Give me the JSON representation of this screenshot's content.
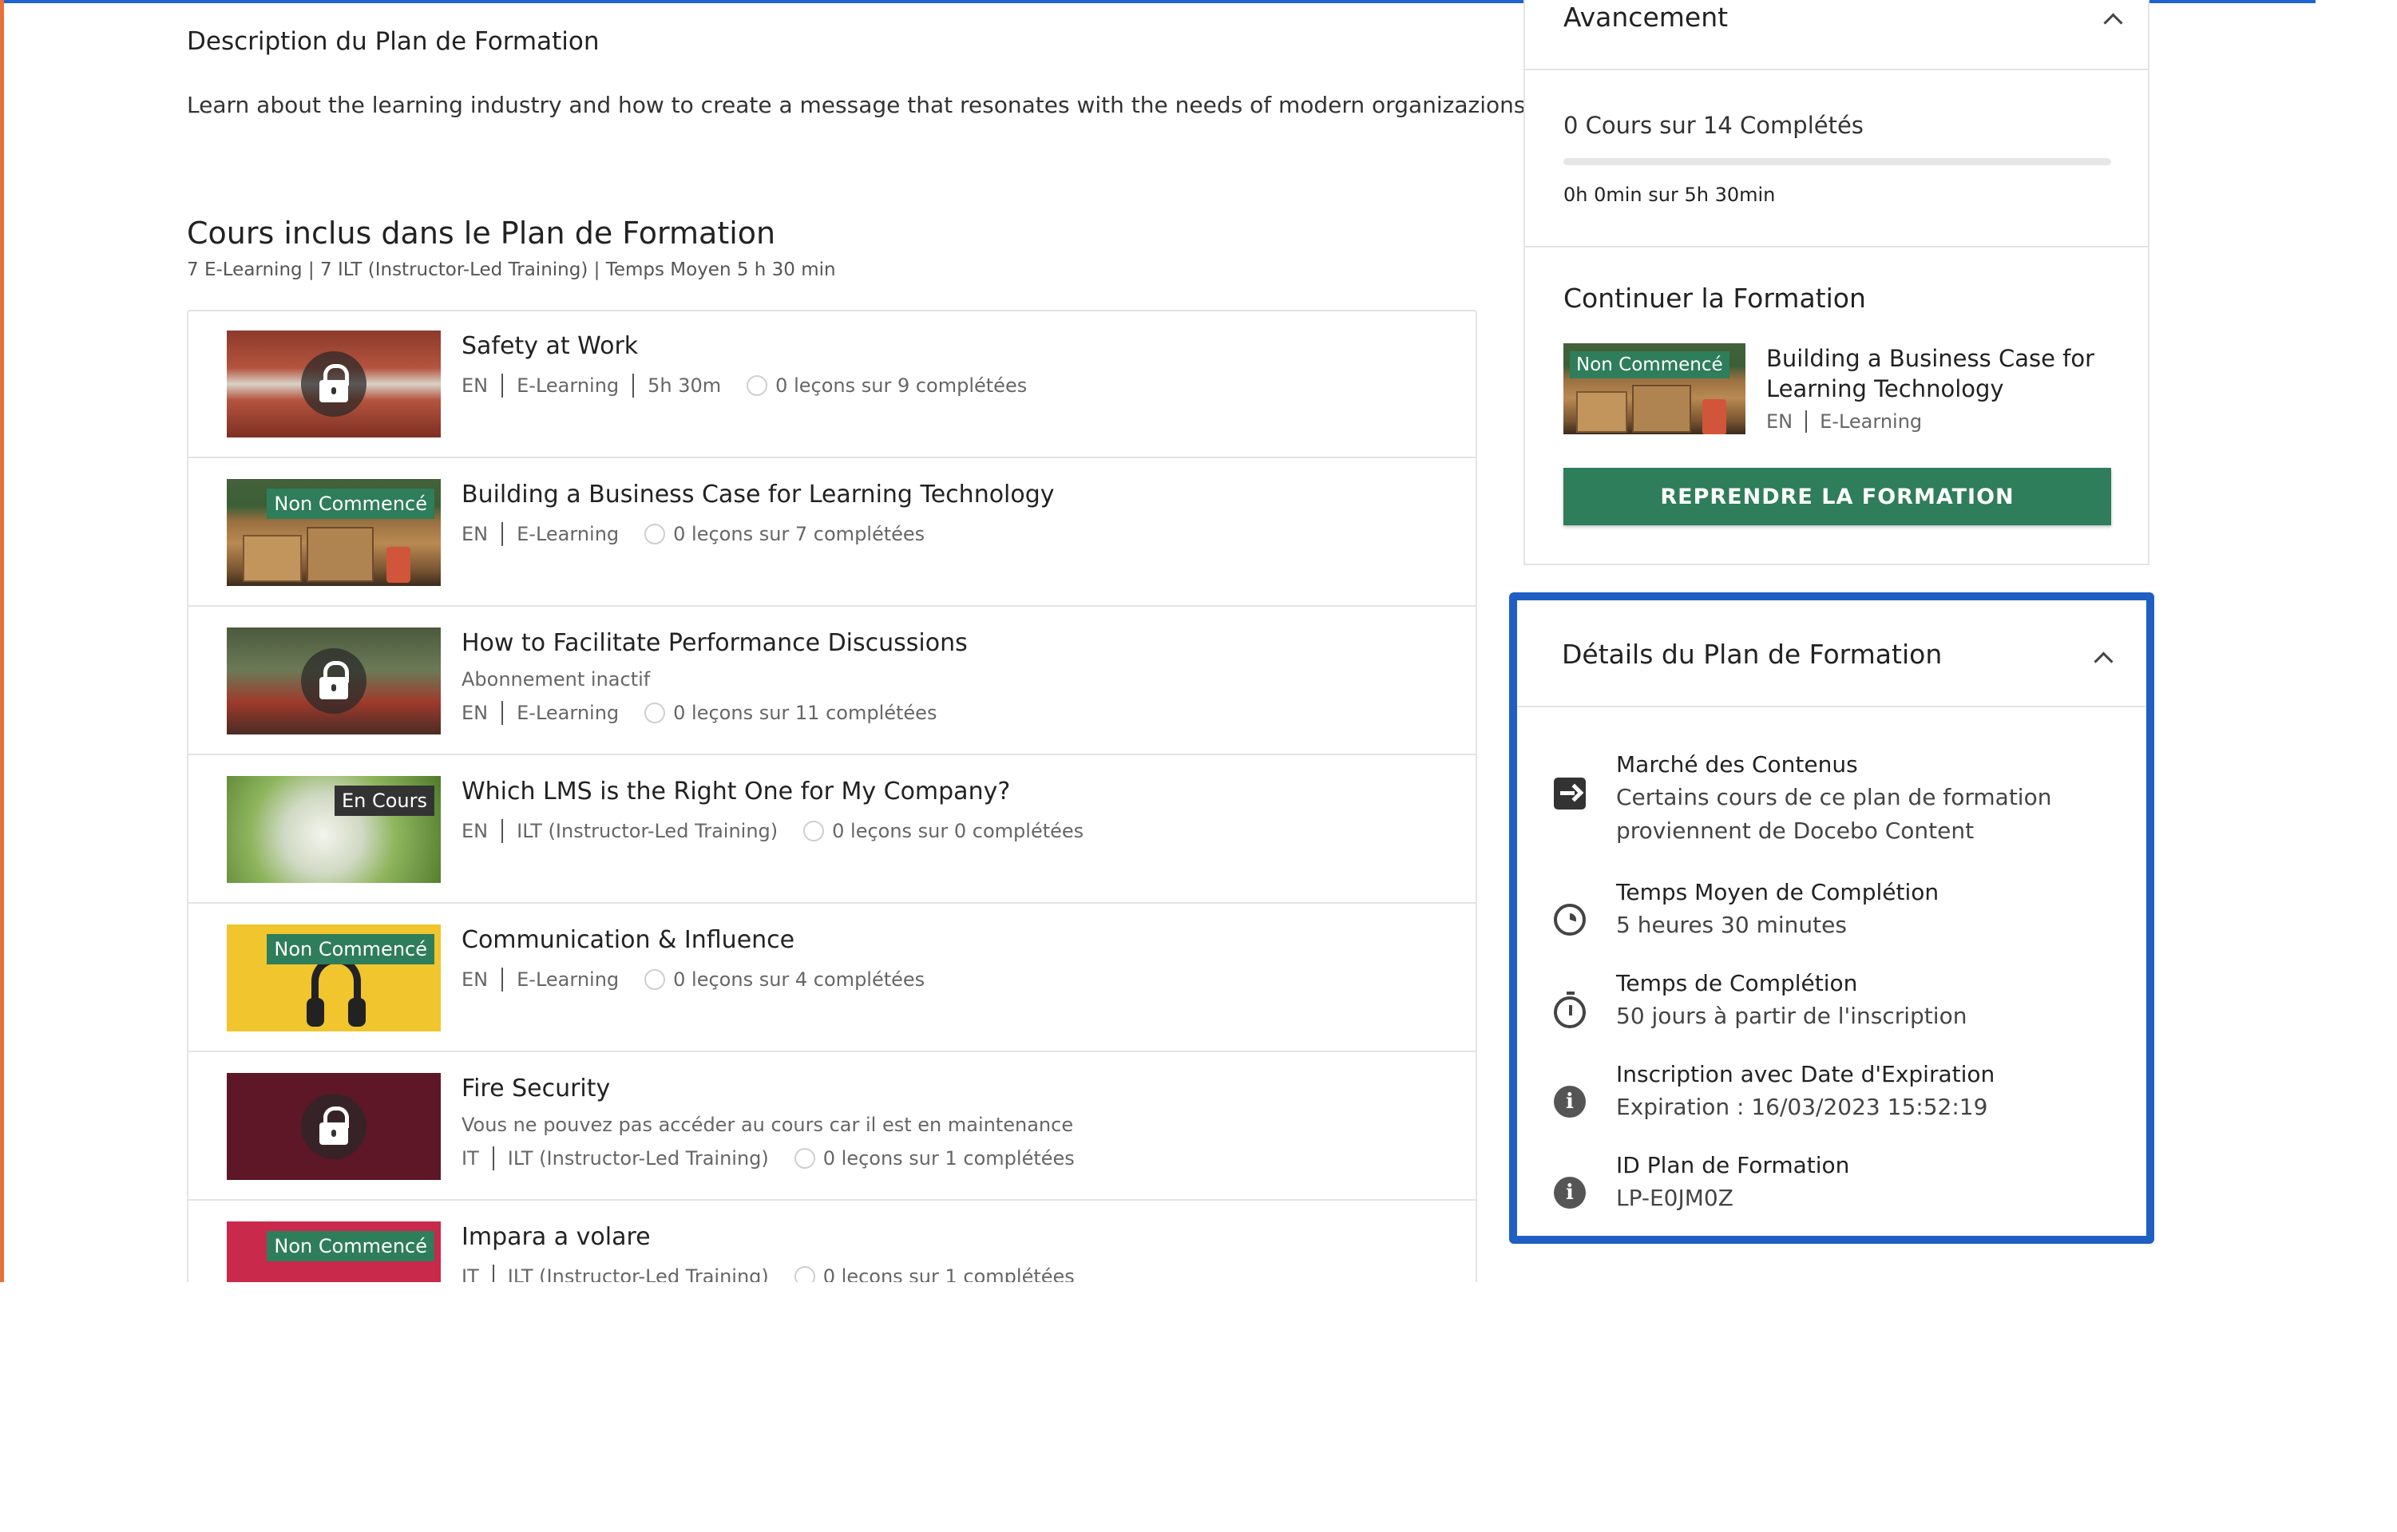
{
  "description": {
    "title": "Description du Plan de Formation",
    "text": "Learn about the learning industry and how to create a message that resonates with the needs of modern organizazions"
  },
  "courses_section": {
    "title": "Cours inclus dans le Plan de Formation",
    "subtitle": "7 E-Learning | 7 ILT (Instructor-Led Training) | Temps Moyen 5 h 30 min"
  },
  "courses": [
    {
      "title": "Safety at Work",
      "lang": "EN",
      "type": "E-Learning",
      "duration": "5h 30m",
      "lessons": "0 leçons sur 9 complétées",
      "locked": true,
      "badge": "",
      "note": ""
    },
    {
      "title": "Building a Business Case for Learning Technology",
      "lang": "EN",
      "type": "E-Learning",
      "duration": "",
      "lessons": "0 leçons sur 7 complétées",
      "locked": false,
      "badge": "Non Commencé",
      "note": ""
    },
    {
      "title": "How to Facilitate Performance Discussions",
      "lang": "EN",
      "type": "E-Learning",
      "duration": "",
      "lessons": "0 leçons sur 11 complétées",
      "locked": true,
      "badge": "",
      "note": "Abonnement inactif"
    },
    {
      "title": "Which LMS is the Right One for My Company?",
      "lang": "EN",
      "type": "ILT (Instructor-Led Training)",
      "duration": "",
      "lessons": "0 leçons sur 0 complétées",
      "locked": false,
      "badge": "En Cours",
      "note": ""
    },
    {
      "title": "Communication & Influence",
      "lang": "EN",
      "type": "E-Learning",
      "duration": "",
      "lessons": "0 leçons sur 4 complétées",
      "locked": false,
      "badge": "Non Commencé",
      "note": ""
    },
    {
      "title": "Fire Security",
      "lang": "IT",
      "type": "ILT (Instructor-Led Training)",
      "duration": "",
      "lessons": "0 leçons sur 1 complétées",
      "locked": true,
      "badge": "",
      "note": "Vous ne pouvez pas accéder au cours car il est en maintenance"
    },
    {
      "title": "Impara a volare",
      "lang": "IT",
      "type": "ILT (Instructor-Led Training)",
      "duration": "",
      "lessons": "0 leçons sur 1 complétées",
      "locked": false,
      "badge": "Non Commencé",
      "note": ""
    }
  ],
  "progress_card": {
    "title": "Avancement",
    "completed_text": "0 Cours sur 14 Complétés",
    "progress_fraction": 0,
    "time_text": "0h 0min sur 5h 30min"
  },
  "continue_card": {
    "title": "Continuer la Formation",
    "badge": "Non Commencé",
    "course_title": "Building a Business Case for Learning Technology",
    "lang": "EN",
    "type": "E-Learning",
    "button_label": "REPRENDRE LA FORMATION"
  },
  "details_card": {
    "title": "Détails du Plan de Formation",
    "items": [
      {
        "icon": "arrow-right-box-icon",
        "label": "Marché des Contenus",
        "value": "Certains cours de ce plan de formation",
        "value2": "proviennent de Docebo Content"
      },
      {
        "icon": "clock-icon",
        "label": "Temps Moyen de Complétion",
        "value": "5 heures 30 minutes"
      },
      {
        "icon": "timer-icon",
        "label": "Temps de Complétion",
        "value": "50 jours à partir de l'inscription"
      },
      {
        "icon": "info-icon",
        "label": "Inscription avec Date d'Expiration",
        "value": "Expiration : 16/03/2023 15:52:19"
      },
      {
        "icon": "info-icon",
        "label": "ID Plan de Formation",
        "value": "LP-E0JM0Z"
      }
    ]
  },
  "colors": {
    "accent_green": "#2e7d5b",
    "highlight_blue": "#1f5fc4",
    "top_bar": "#1f63cf",
    "left_edge": "#e8713a"
  }
}
